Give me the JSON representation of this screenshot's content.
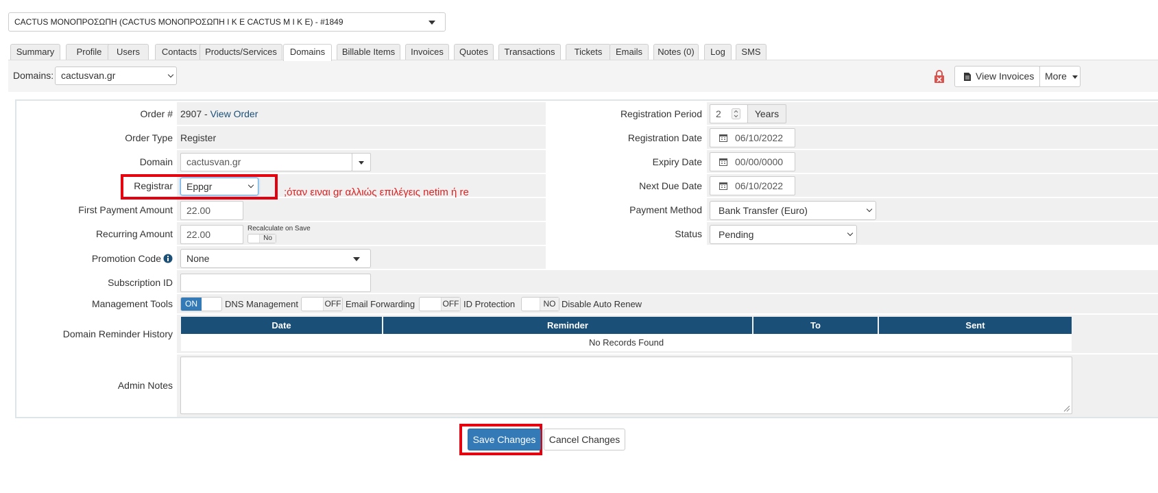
{
  "client": {
    "selected": "CACTUS ΜΟΝΟΠΡΟΣΩΠΗ (CACTUS ΜΟΝΟΠΡΟΣΩΠΗ Ι Κ Ε CACTUS Μ Ι Κ Ε) - #1849"
  },
  "tabs": [
    {
      "label": "Summary"
    },
    {
      "label": "Profile"
    },
    {
      "label": "Users"
    },
    {
      "label": "Contacts"
    },
    {
      "label": "Products/Services"
    },
    {
      "label": "Domains",
      "active": true
    },
    {
      "label": "Billable Items"
    },
    {
      "label": "Invoices"
    },
    {
      "label": "Quotes"
    },
    {
      "label": "Transactions"
    },
    {
      "label": "Tickets"
    },
    {
      "label": "Emails"
    },
    {
      "label": "Notes (0)"
    },
    {
      "label": "Log"
    },
    {
      "label": "SMS"
    }
  ],
  "toolbar": {
    "domains_label": "Domains:",
    "domain_selected": "cactusvan.gr",
    "view_invoices": "View Invoices",
    "more": "More"
  },
  "form": {
    "order_label": "Order #",
    "order_number": "2907 - ",
    "view_order": "View Order",
    "order_type_label": "Order Type",
    "order_type": "Register",
    "domain_label": "Domain",
    "domain_value": "cactusvan.gr",
    "registrar_label": "Registrar",
    "registrar_value": "Eppgr",
    "annotation": ";όταν ειναι gr    αλλιώς επιλέγεις netim ή re",
    "first_payment_label": "First Payment Amount",
    "first_payment_value": "22.00",
    "recurring_label": "Recurring Amount",
    "recurring_value": "22.00",
    "recalculate_label": "Recalculate on Save",
    "recalculate_value": "No",
    "promotion_label": "Promotion Code",
    "promotion_value": "None",
    "subscription_label": "Subscription ID",
    "subscription_value": "",
    "management_label": "Management Tools",
    "tools": [
      {
        "state": "ON",
        "label": "DNS Management"
      },
      {
        "state": "OFF",
        "label": "Email Forwarding"
      },
      {
        "state": "OFF",
        "label": "ID Protection"
      },
      {
        "state": "NO",
        "label": "Disable Auto Renew"
      }
    ],
    "reminder_label": "Domain Reminder History",
    "reminder_columns": [
      "Date",
      "Reminder",
      "To",
      "Sent"
    ],
    "reminder_empty": "No Records Found",
    "admin_notes_label": "Admin Notes",
    "admin_notes_value": "",
    "reg_period_label": "Registration Period",
    "reg_period_value": "2",
    "reg_period_unit": "Years",
    "reg_date_label": "Registration Date",
    "reg_date_value": "06/10/2022",
    "expiry_label": "Expiry Date",
    "expiry_value": "00/00/0000",
    "next_due_label": "Next Due Date",
    "next_due_value": "06/10/2022",
    "payment_method_label": "Payment Method",
    "payment_method_value": "Bank Transfer (Euro)",
    "status_label": "Status",
    "status_value": "Pending"
  },
  "actions": {
    "save": "Save Changes",
    "cancel": "Cancel Changes"
  },
  "colors": {
    "accent": "#337ab7",
    "table_header": "#1a4f78",
    "highlight": "#e4000f"
  }
}
